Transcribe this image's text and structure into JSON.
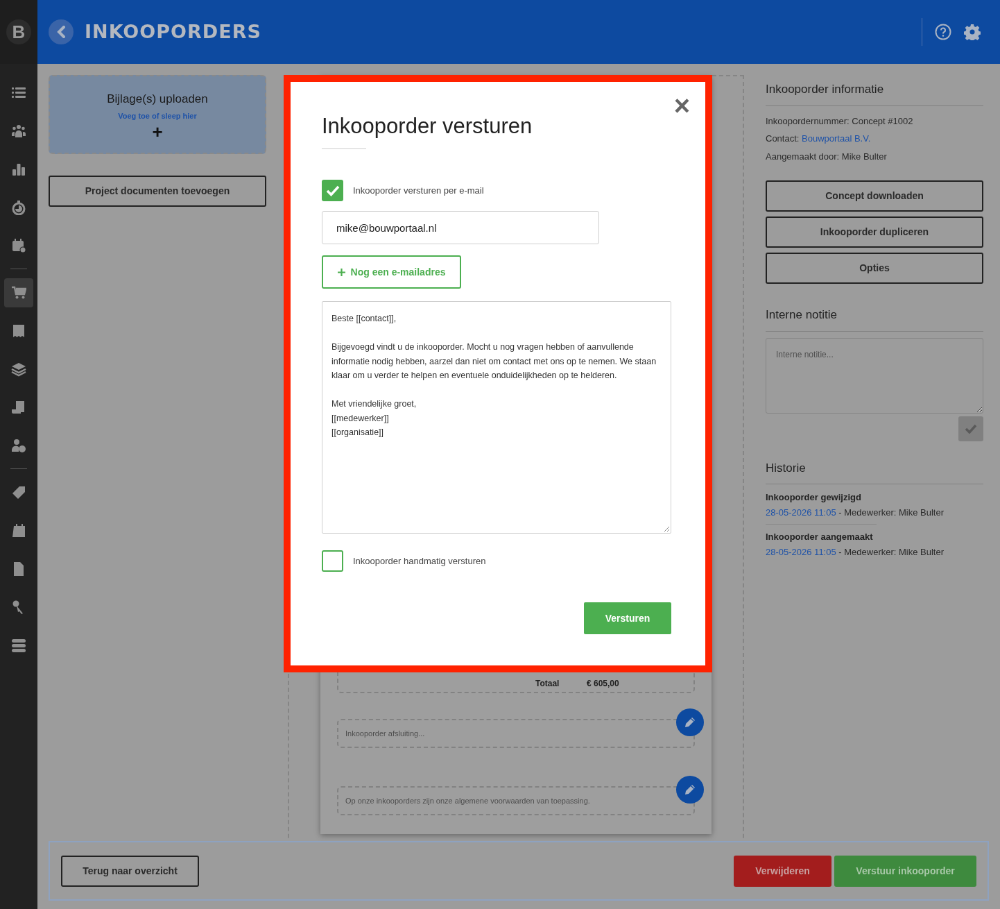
{
  "header": {
    "logo": "B",
    "title": "INKOOPORDERS"
  },
  "sidebar": {
    "groups": [
      [
        {
          "selected": false
        },
        {
          "selected": false
        },
        {
          "selected": false
        },
        {
          "selected": false
        },
        {
          "selected": false
        }
      ],
      [
        {
          "selected": true
        },
        {
          "selected": false
        },
        {
          "selected": false
        },
        {
          "selected": false
        },
        {
          "selected": false
        }
      ],
      [
        {
          "selected": false
        },
        {
          "selected": false
        },
        {
          "selected": false
        },
        {
          "selected": false
        },
        {
          "selected": false
        }
      ]
    ]
  },
  "upload": {
    "title": "Bijlage(s) uploaden",
    "hint": "Voeg toe of sleep hier",
    "plus": "+"
  },
  "project_docs_button": "Project documenten toevoegen",
  "document": {
    "total_label": "Totaal",
    "total_value": "€ 605,00",
    "closing_placeholder": "Inkooporder afsluiting...",
    "terms": "Op onze inkooporders zijn onze algemene voorwaarden van toepassing."
  },
  "info": {
    "title": "Inkooporder informatie",
    "number": "Inkoopordernummer: Concept #1002",
    "contact_label": "Contact: ",
    "contact_link": "Bouwportaal B.V.",
    "created_by": "Aangemaakt door: Mike Bulter",
    "buttons": [
      "Concept downloaden",
      "Inkooporder dupliceren",
      "Opties"
    ]
  },
  "note": {
    "title": "Interne notitie",
    "placeholder": "Interne notitie..."
  },
  "history": {
    "title": "Historie",
    "entries": [
      {
        "title": "Inkooporder gewijzigd",
        "date": "28-05-2026 11:05",
        "detail": " - Medewerker: Mike Bulter"
      },
      {
        "title": "Inkooporder aangemaakt",
        "date": "28-05-2026 11:05",
        "detail": " - Medewerker: Mike Bulter"
      }
    ]
  },
  "footer": {
    "back": "Terug naar overzicht",
    "delete": "Verwijderen",
    "send": "Verstuur inkooporder"
  },
  "modal": {
    "title": "Inkooporder versturen",
    "close": "×",
    "email_option": {
      "label": "Inkooporder versturen per e-mail",
      "checked": true
    },
    "email": "mike@bouwportaal.nl",
    "add_email": "Nog een e-mailadres",
    "message": "Beste [[contact]],\n\nBijgevoegd vindt u de inkooporder. Mocht u nog vragen hebben of aanvullende informatie nodig hebben, aarzel dan niet om contact met ons op te nemen. We staan klaar om u verder te helpen en eventuele onduidelijkheden op te helderen.\n\nMet vriendelijke groet,\n[[medewerker]]\n[[organisatie]]",
    "manual_option": {
      "label": "Inkooporder handmatig versturen",
      "checked": false
    },
    "submit": "Versturen"
  }
}
